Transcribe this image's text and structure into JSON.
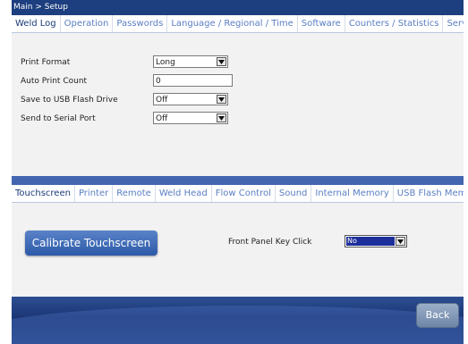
{
  "breadcrumb": "Main > Setup",
  "top_tabs": [
    {
      "label": "Weld Log",
      "active": true
    },
    {
      "label": "Operation",
      "active": false
    },
    {
      "label": "Passwords",
      "active": false
    },
    {
      "label": "Language / Regional / Time",
      "active": false
    },
    {
      "label": "Software",
      "active": false
    },
    {
      "label": "Counters / Statistics",
      "active": false
    },
    {
      "label": "Service",
      "active": false
    }
  ],
  "weld_log": {
    "print_format": {
      "label": "Print Format",
      "value": "Long"
    },
    "auto_print_count": {
      "label": "Auto Print Count",
      "value": "0"
    },
    "save_usb": {
      "label": "Save to USB Flash Drive",
      "value": "Off"
    },
    "send_serial": {
      "label": "Send to Serial Port",
      "value": "Off"
    }
  },
  "bottom_tabs": [
    {
      "label": "Touchscreen",
      "active": true
    },
    {
      "label": "Printer",
      "active": false
    },
    {
      "label": "Remote",
      "active": false
    },
    {
      "label": "Weld Head",
      "active": false
    },
    {
      "label": "Flow Control",
      "active": false
    },
    {
      "label": "Sound",
      "active": false
    },
    {
      "label": "Internal Memory",
      "active": false
    },
    {
      "label": "USB Flash Memory",
      "active": false
    }
  ],
  "touchscreen": {
    "calibrate_label": "Calibrate Touchscreen",
    "key_click_label": "Front Panel Key Click",
    "key_click_value": "No"
  },
  "footer": {
    "back_label": "Back"
  }
}
